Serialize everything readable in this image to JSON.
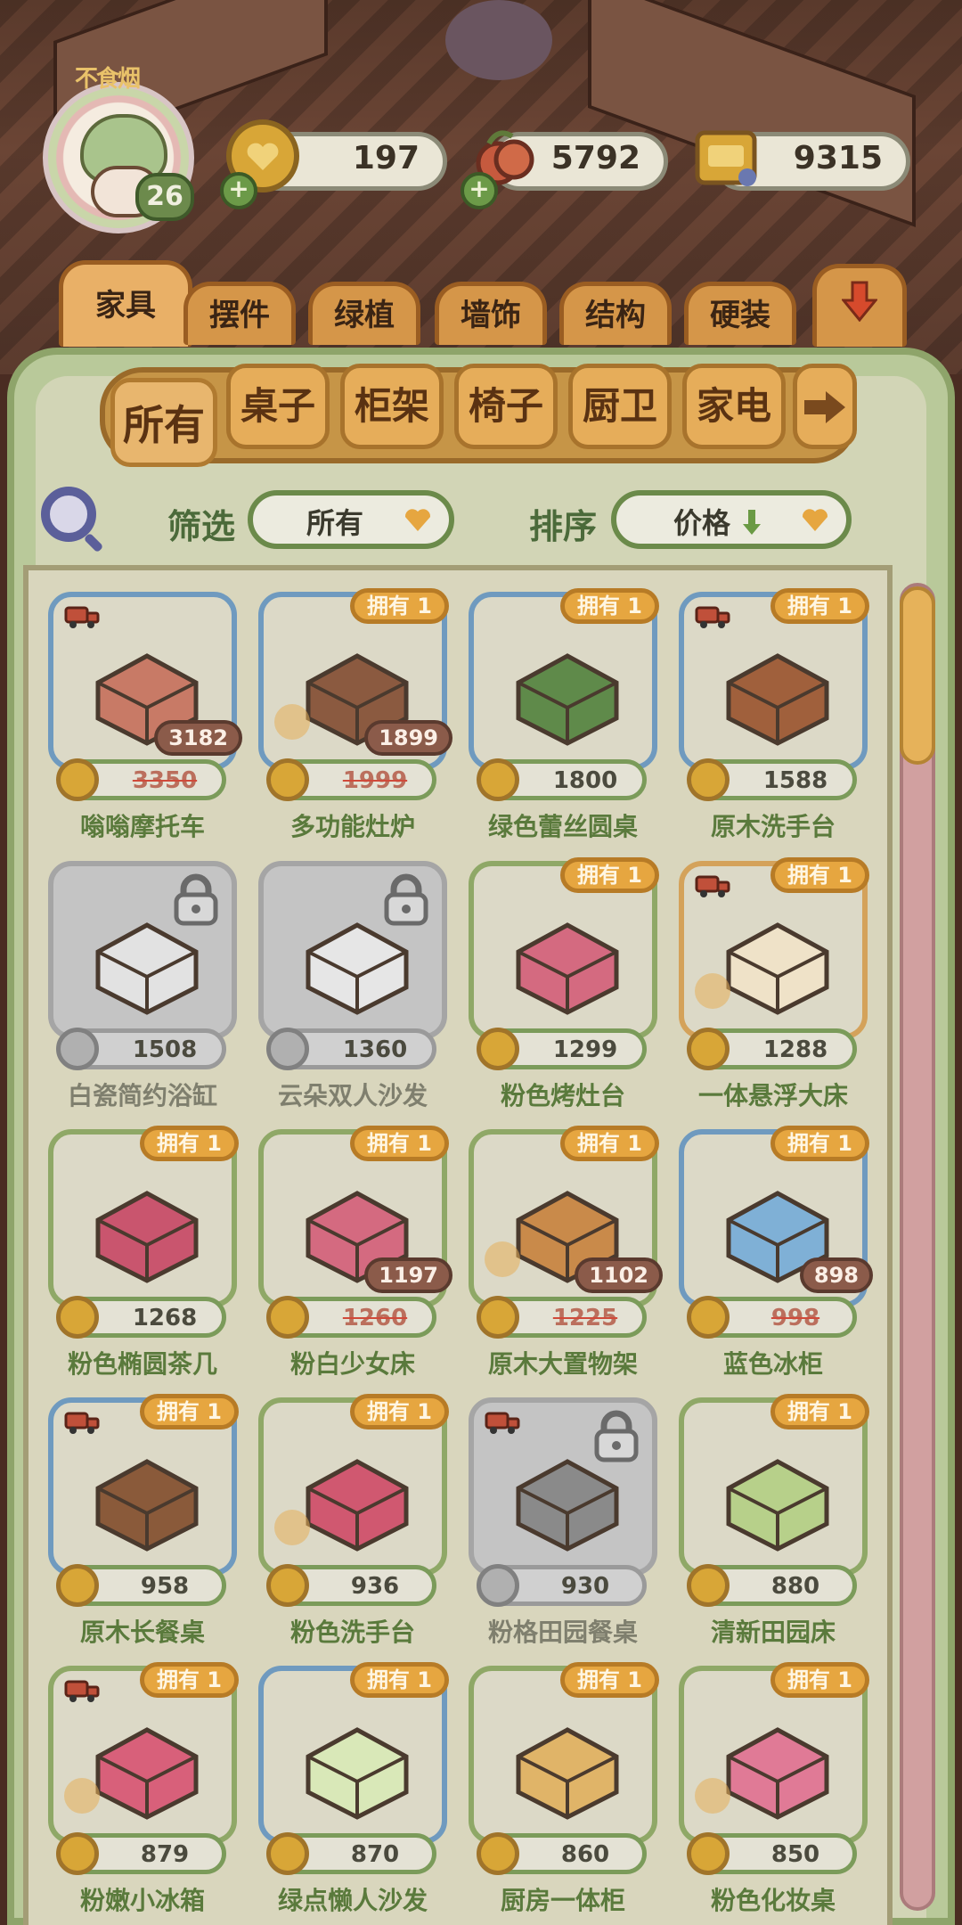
{
  "player": {
    "level": "26",
    "badge_text": "不食烟"
  },
  "resources": [
    {
      "name": "coin-resource",
      "value": "197"
    },
    {
      "name": "fruit-resource",
      "value": "5792"
    },
    {
      "name": "ticket-resource",
      "value": "9315"
    }
  ],
  "category_tabs": [
    "家具",
    "摆件",
    "绿植",
    "墙饰",
    "结构",
    "硬装"
  ],
  "sub_tabs": [
    "所有",
    "桌子",
    "柜架",
    "椅子",
    "厨卫",
    "家电"
  ],
  "filter": {
    "label": "筛选",
    "value": "所有"
  },
  "sort": {
    "label": "排序",
    "value": "价格"
  },
  "owned_label": "拥有 1",
  "items": [
    {
      "name": "嗡嗡摩托车",
      "price": "3350",
      "sale": "3182",
      "owned": false,
      "locked": false,
      "frame": "blue",
      "truck": true
    },
    {
      "name": "多功能灶炉",
      "price": "1999",
      "sale": "1899",
      "owned": true,
      "locked": false,
      "frame": "blue",
      "truck": false
    },
    {
      "name": "绿色蕾丝圆桌",
      "price": "1800",
      "sale": "",
      "owned": true,
      "locked": false,
      "frame": "blue",
      "truck": false
    },
    {
      "name": "原木洗手台",
      "price": "1588",
      "sale": "",
      "owned": true,
      "locked": false,
      "frame": "blue",
      "truck": true
    },
    {
      "name": "白瓷简约浴缸",
      "price": "1508",
      "sale": "",
      "owned": false,
      "locked": true,
      "frame": "grey",
      "truck": false
    },
    {
      "name": "云朵双人沙发",
      "price": "1360",
      "sale": "",
      "owned": false,
      "locked": true,
      "frame": "grey",
      "truck": false
    },
    {
      "name": "粉色烤灶台",
      "price": "1299",
      "sale": "",
      "owned": true,
      "locked": false,
      "frame": "green",
      "truck": false
    },
    {
      "name": "一体悬浮大床",
      "price": "1288",
      "sale": "",
      "owned": true,
      "locked": false,
      "frame": "orange",
      "truck": true
    },
    {
      "name": "粉色椭圆茶几",
      "price": "1268",
      "sale": "",
      "owned": true,
      "locked": false,
      "frame": "green",
      "truck": false
    },
    {
      "name": "粉白少女床",
      "price": "1260",
      "sale": "1197",
      "owned": true,
      "locked": false,
      "frame": "green",
      "truck": false
    },
    {
      "name": "原木大置物架",
      "price": "1225",
      "sale": "1102",
      "owned": true,
      "locked": false,
      "frame": "green",
      "truck": false
    },
    {
      "name": "蓝色冰柜",
      "price": "998",
      "sale": "898",
      "owned": true,
      "locked": false,
      "frame": "blue",
      "truck": false
    },
    {
      "name": "原木长餐桌",
      "price": "958",
      "sale": "",
      "owned": true,
      "locked": false,
      "frame": "blue",
      "truck": true
    },
    {
      "name": "粉色洗手台",
      "price": "936",
      "sale": "",
      "owned": true,
      "locked": false,
      "frame": "green",
      "truck": false
    },
    {
      "name": "粉格田园餐桌",
      "price": "930",
      "sale": "",
      "owned": false,
      "locked": true,
      "frame": "grey",
      "truck": true
    },
    {
      "name": "清新田园床",
      "price": "880",
      "sale": "",
      "owned": true,
      "locked": false,
      "frame": "green",
      "truck": false
    },
    {
      "name": "粉嫩小冰箱",
      "price": "879",
      "sale": "",
      "owned": true,
      "locked": false,
      "frame": "green",
      "truck": true
    },
    {
      "name": "绿点懒人沙发",
      "price": "870",
      "sale": "",
      "owned": true,
      "locked": false,
      "frame": "blue",
      "truck": false
    },
    {
      "name": "厨房一体柜",
      "price": "860",
      "sale": "",
      "owned": true,
      "locked": false,
      "frame": "green",
      "truck": false
    },
    {
      "name": "粉色化妆桌",
      "price": "850",
      "sale": "",
      "owned": true,
      "locked": false,
      "frame": "green",
      "truck": false
    }
  ],
  "icons": {
    "search": "search-icon",
    "filter_dropdown": "heart-dropdown-icon",
    "sort_dropdown": "heart-dropdown-icon",
    "sort_direction": "arrow-down-icon",
    "next_tab": "arrow-right-icon",
    "expand": "arrow-down-icon"
  },
  "colors": {
    "panel_green": "#b9c99a",
    "tab_orange": "#e6ad5a",
    "owned_badge": "#e6a640",
    "coin": "#d8a637"
  }
}
